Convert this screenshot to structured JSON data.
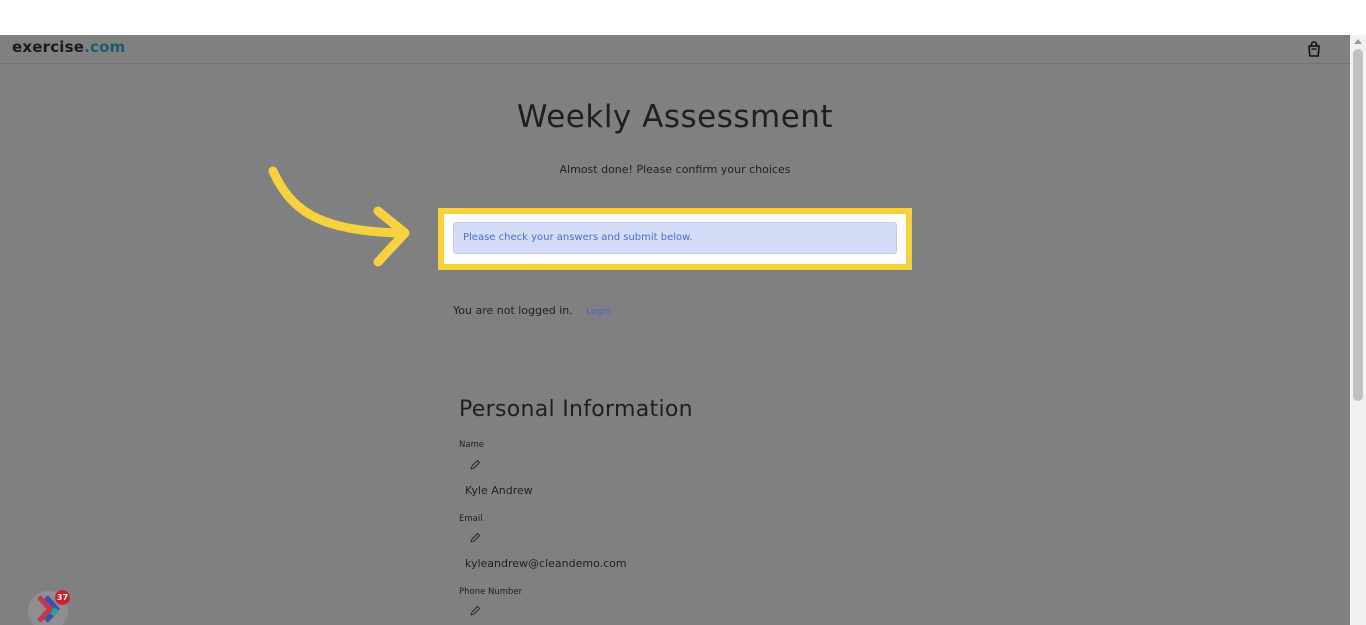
{
  "navbar": {
    "brand_name": "exercise",
    "brand_tld": ".com",
    "cart_icon": "shopping-bag-icon"
  },
  "header": {
    "title": "Weekly Assessment",
    "subtitle": "Almost done! Please confirm your choices"
  },
  "alert": {
    "message": "Please check your answers and submit below."
  },
  "auth": {
    "status_text": "You are not logged in.",
    "login_label": "Login"
  },
  "personal_info": {
    "title": "Personal Information",
    "fields": [
      {
        "label": "Name",
        "value": "Kyle Andrew"
      },
      {
        "label": "Email",
        "value": "kyleandrew@cleandemo.com"
      },
      {
        "label": "Phone Number",
        "value": ""
      }
    ],
    "edit_icon": "pencil-icon"
  },
  "widget": {
    "badge_count": "37"
  },
  "colors": {
    "overlay": "#808080",
    "highlight": "#f7d23e",
    "alert_bg": "#d4dcf8",
    "alert_text": "#4a6de0",
    "link": "#3d63d6",
    "brand_tld": "#1d5a6e",
    "badge": "#c8232c"
  }
}
